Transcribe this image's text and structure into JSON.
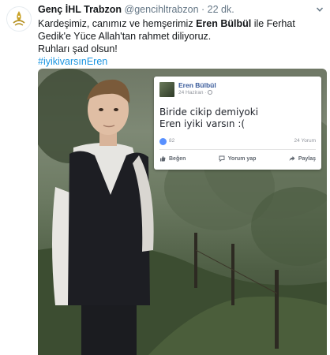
{
  "tweet": {
    "display_name": "Genç İHL Trabzon",
    "handle": "@gencihltrabzon",
    "separator": "·",
    "time": "22 dk.",
    "text_part1": "Kardeşimiz, canımız ve hemşerimiz ",
    "text_bold": "Eren Bülbül",
    "text_part2": " ile Ferhat Gedik'e Yüce Allah'tan rahmet diliyoruz.",
    "text_line2": "Ruhları şad olsun!",
    "hashtag": "#iyikivarsınEren",
    "colors": {
      "name": "#14171a",
      "meta": "#657786",
      "hashtag": "#1b95e0"
    }
  },
  "embedded_fb_post": {
    "author": "Eren Bülbül",
    "date": "24 Haziran ·",
    "post_line1": "Biride cikip demiyoki",
    "post_line2": "Eren iyiki varsın :(",
    "likes_count": "82",
    "comments_count": "24 Yorum",
    "actions": {
      "like": "Beğen",
      "comment": "Yorum yap",
      "share": "Paylaş"
    },
    "colors": {
      "author": "#365899",
      "like_badge": "#5890ff"
    }
  },
  "icons": {
    "avatar": "organization-logo-icon",
    "menu": "chevron-down-icon",
    "fb_like": "thumbs-up-icon",
    "fb_comment": "comment-bubble-icon",
    "fb_share": "share-arrow-icon"
  }
}
